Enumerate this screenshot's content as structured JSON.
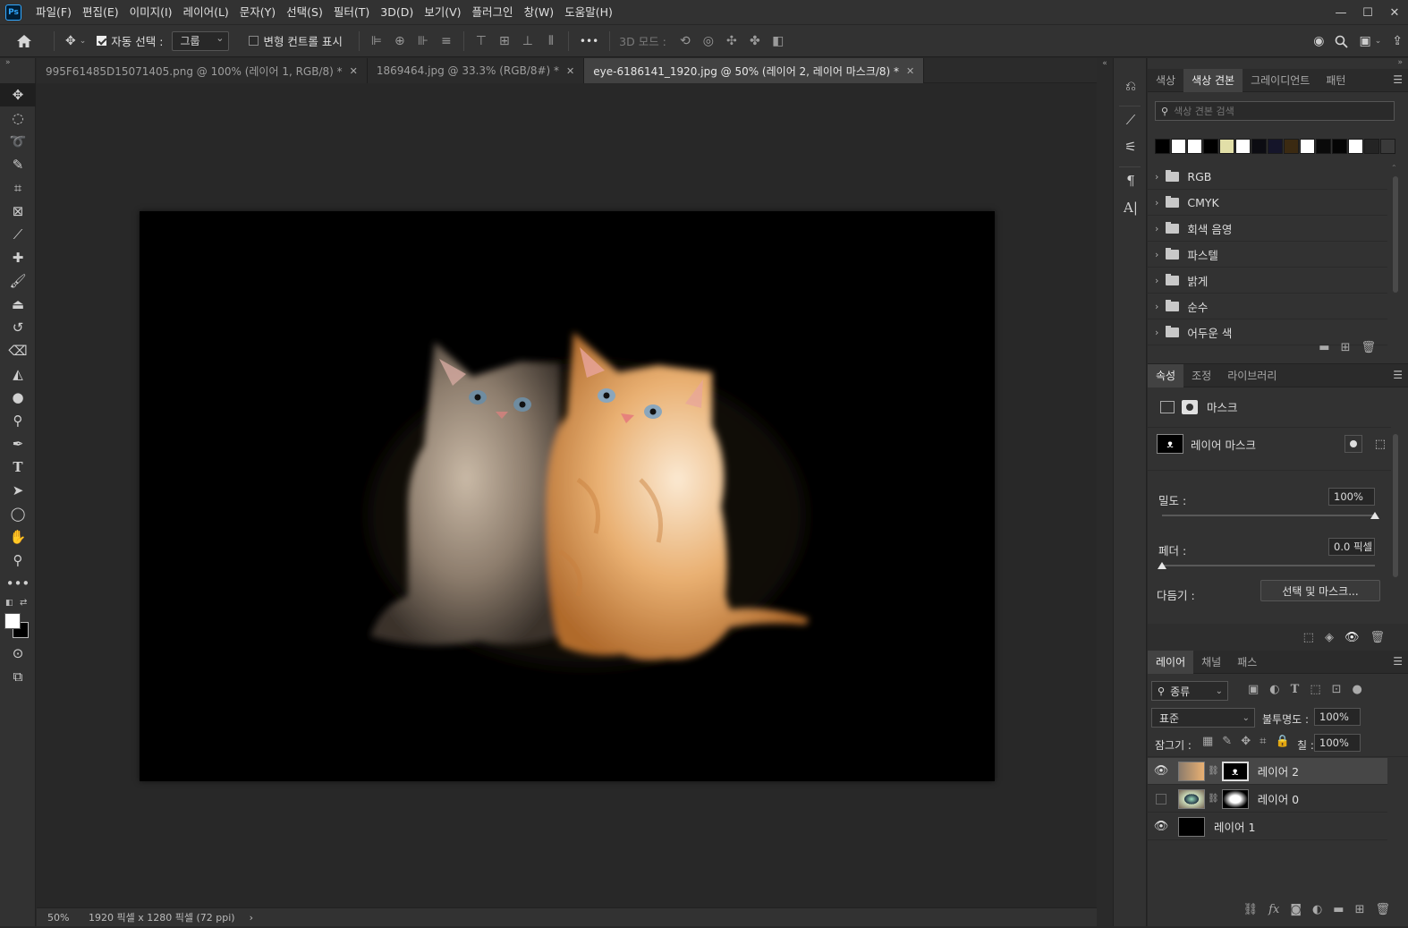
{
  "menubar": {
    "logo": "Ps",
    "items": [
      "파일(F)",
      "편집(E)",
      "이미지(I)",
      "레이어(L)",
      "문자(Y)",
      "선택(S)",
      "필터(T)",
      "3D(D)",
      "보기(V)",
      "플러그인",
      "창(W)",
      "도움말(H)"
    ],
    "window_controls": [
      "—",
      "☐",
      "✕"
    ]
  },
  "options": {
    "auto_select_label": "자동 선택 :",
    "auto_select_value": "그룹",
    "transform_controls_label": "변형 컨트롤 표시",
    "more_label": "•••",
    "mode3d_label": "3D 모드 :"
  },
  "tabs": [
    {
      "title": "995F61485D15071405.png @ 100% (레이어 1, RGB/8) *",
      "active": false
    },
    {
      "title": "1869464.jpg @ 33.3% (RGB/8#) *",
      "active": false
    },
    {
      "title": "eye-6186141_1920.jpg @ 50% (레이어 2, 레이어 마스크/8) *",
      "active": true
    }
  ],
  "status": {
    "zoom": "50%",
    "doc_info": "1920 픽셀 x 1280 픽셀 (72 ppi)",
    "arrow": "›"
  },
  "swatches_panel": {
    "tabs": [
      "색상",
      "색상 견본",
      "그레이디언트",
      "패턴"
    ],
    "active_tab": 1,
    "search_placeholder": "색상 견본 검색",
    "swatch_colors": [
      "#000000",
      "#ffffff",
      "#ffffff",
      "#000000",
      "#e2dfa8",
      "#ffffff",
      "#0c0c12",
      "#15152a",
      "#3b2a12",
      "#ffffff",
      "#0a0a0a",
      "#050505",
      "#ffffff",
      "#242424",
      "#3a3a3a"
    ],
    "groups": [
      "RGB",
      "CMYK",
      "회색 음영",
      "파스텔",
      "밝게",
      "순수",
      "어두운 색"
    ]
  },
  "properties_panel": {
    "tabs": [
      "속성",
      "조정",
      "라이브러리"
    ],
    "active_tab": 0,
    "type_label": "마스크",
    "mask_label": "레이어 마스크",
    "density_label": "밀도 :",
    "density_value": "100%",
    "density_fraction": 1.0,
    "feather_label": "페더 :",
    "feather_value": "0.0 픽셀",
    "feather_fraction": 0.0,
    "refine_label": "다듬기 :",
    "refine_button": "선택 및 마스크..."
  },
  "layers_panel": {
    "tabs": [
      "레이어",
      "채널",
      "패스"
    ],
    "active_tab": 0,
    "filter_label": "종류",
    "blend_mode": "표준",
    "opacity_label": "불투명도 :",
    "opacity_value": "100%",
    "lock_label": "잠그기 :",
    "fill_label": "칠 :",
    "fill_value": "100%",
    "layers": [
      {
        "name": "레이어 2",
        "visible": true,
        "selected": true,
        "has_mask": true
      },
      {
        "name": "레이어 0",
        "visible": false,
        "selected": false,
        "has_mask": true
      },
      {
        "name": "레이어 1",
        "visible": true,
        "selected": false,
        "has_mask": false
      }
    ]
  }
}
